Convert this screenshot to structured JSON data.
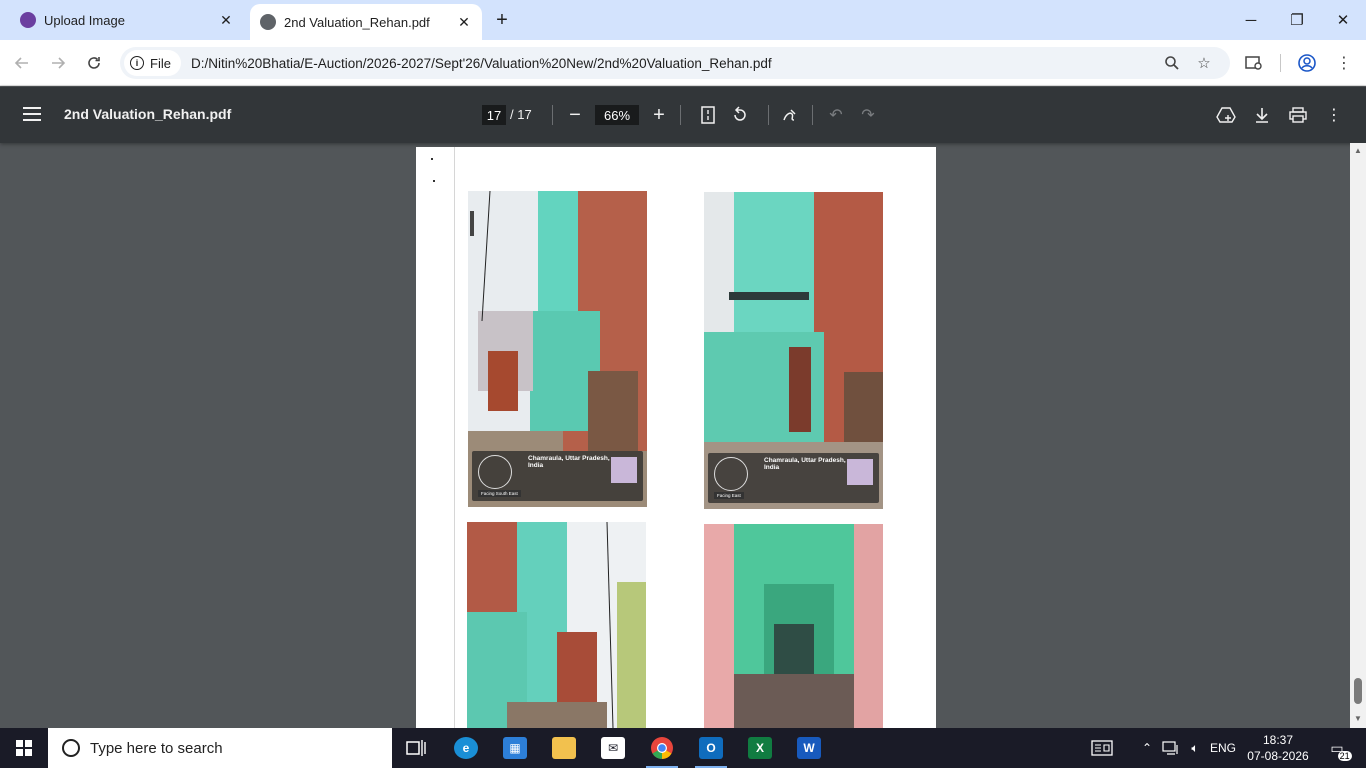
{
  "browser": {
    "tabs": [
      {
        "title": "Upload Image",
        "active": false
      },
      {
        "title": "2nd Valuation_Rehan.pdf",
        "active": true
      }
    ],
    "new_tab_glyph": "+",
    "window_controls": {
      "minimize": "─",
      "restore": "❐",
      "close": "✕"
    },
    "chip_label": "File",
    "url": "D:/Nitin%20Bhatia/E-Auction/2026-2027/Sept'26/Valuation%20New/2nd%20Valuation_Rehan.pdf",
    "icons": {
      "back": "back-arrow-icon",
      "forward": "forward-arrow-icon",
      "reload": "reload-icon",
      "zoom": "zoom-icon",
      "bookmark": "star-icon",
      "reading_list": "reading-mode-icon",
      "profile": "profile-icon",
      "menu": "kebab-menu-icon"
    }
  },
  "pdf_viewer": {
    "doc_title": "2nd Valuation_Rehan.pdf",
    "current_page": "17",
    "page_separator": "/",
    "total_pages": "17",
    "zoom": "66%",
    "zoom_out": "−",
    "zoom_in": "+"
  },
  "page_content": {
    "photos": [
      {
        "location": "Chamraula, Uttar Pradesh, India",
        "tag": "Facing South East"
      },
      {
        "location": "Chamraula, Uttar Pradesh, India",
        "tag": "Facing East"
      },
      {
        "location": "",
        "tag": ""
      },
      {
        "location": "",
        "tag": ""
      }
    ]
  },
  "taskbar": {
    "search_placeholder": "Type here to search",
    "language": "ENG",
    "time": "18:37",
    "date": "07-08-2026",
    "notification_count": "21",
    "apps": [
      "task-view",
      "edge",
      "microsoft-store",
      "file-explorer",
      "mail",
      "chrome",
      "outlook",
      "excel",
      "word"
    ],
    "colors": {
      "edge": "#1a8fd6",
      "store": "#2d7fd8",
      "explorer": "#f2c14e",
      "chrome": "#e8453c",
      "outlook": "#0f6cbd",
      "excel": "#107c41",
      "word": "#185abd"
    }
  }
}
